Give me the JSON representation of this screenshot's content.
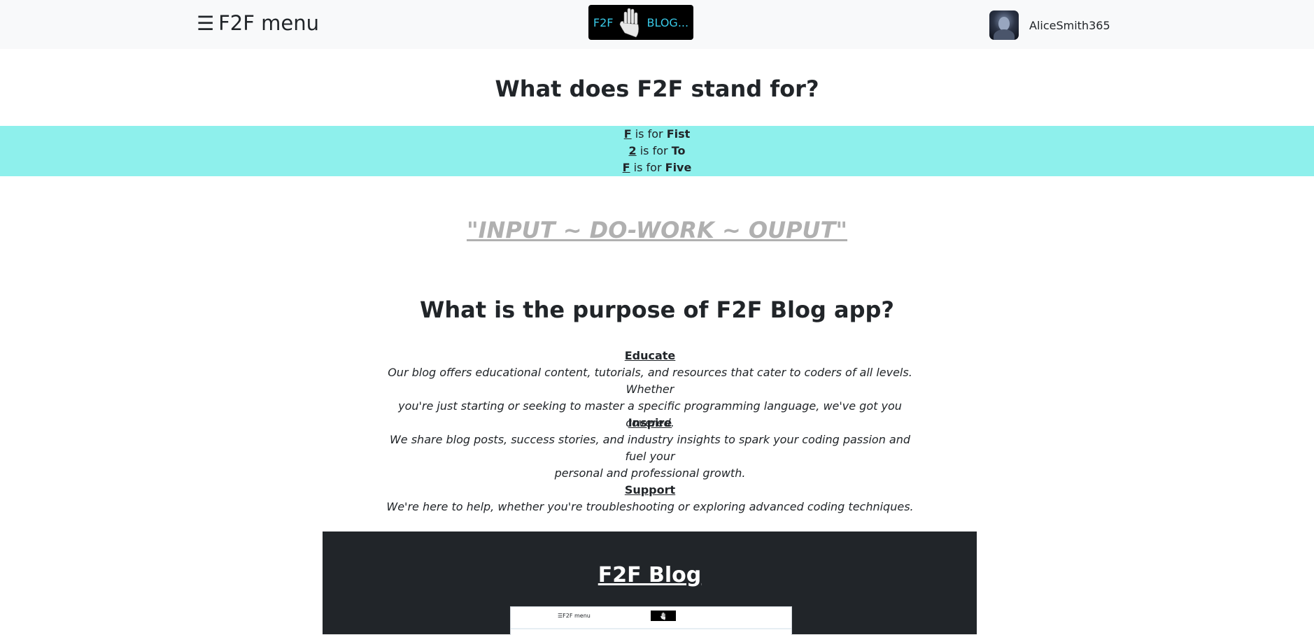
{
  "navbar": {
    "menu_icon": "☰",
    "menu_label": "F2F menu",
    "logo": {
      "left_text": "F2F",
      "right_text": "BLOG...",
      "icon": "hand-icon"
    },
    "username": "AliceSmith365",
    "avatar": "avatar-image"
  },
  "stand_for": {
    "heading": "What does F2F stand for?",
    "rows": [
      {
        "letter": "F",
        "middle": "is for",
        "word": "Fist"
      },
      {
        "letter": "2",
        "middle": "is for",
        "word": "To"
      },
      {
        "letter": "F",
        "middle": "is for",
        "word": "Five"
      }
    ]
  },
  "motto": "\"INPUT ~ DO-WORK ~ OUPUT\"",
  "purpose": {
    "heading": "What is the purpose of F2F Blog app?",
    "items": [
      {
        "title": "Educate",
        "line1": "Our blog offers educational content, tutorials, and resources that cater to coders of all levels. Whether",
        "line2": "you're just starting or seeking to master a specific programming language, we've got you covered."
      },
      {
        "title": "Inspire",
        "line1": "We share blog posts, success stories, and industry insights to spark your coding passion and fuel your",
        "line2": "personal and professional growth."
      },
      {
        "title": "Support",
        "line1": "We're here to help, whether you're troubleshooting or exploring advanced coding techniques."
      }
    ]
  },
  "blog_section": {
    "title": "F2F Blog",
    "preview_menu": "☰F2F menu"
  },
  "colors": {
    "navbar_bg": "#f8f9fa",
    "band_bg": "#8ef0ec",
    "logo_accent": "#38c8e6",
    "motto": "#b0b0b0",
    "dark_section": "#212529"
  }
}
